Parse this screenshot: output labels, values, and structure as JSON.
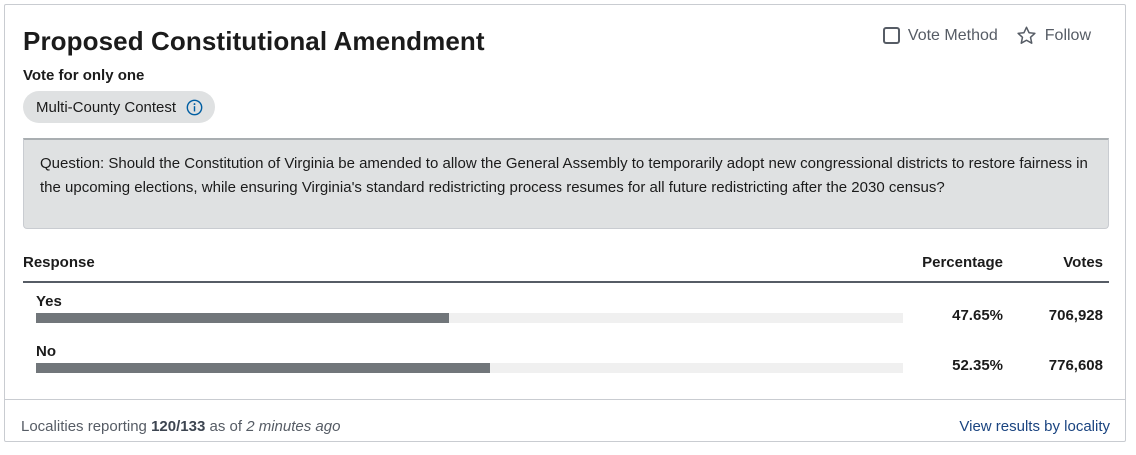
{
  "contest": {
    "title": "Proposed Constitutional Amendment",
    "subtitle": "Vote for only one",
    "scope_label": "Multi-County Contest",
    "info_icon": "info-icon"
  },
  "actions": {
    "vote_method_label": "Vote Method",
    "vote_method_checked": false,
    "follow_label": "Follow",
    "follow_icon": "star-outline-icon"
  },
  "question_text": "Question: Should the Constitution of Virginia be amended to allow the General Assembly to temporarily adopt new congressional districts to restore fairness in the upcoming elections, while ensuring Virginia's standard redistricting process resumes for all future redistricting after the 2030 census?",
  "table": {
    "headers": {
      "response": "Response",
      "percentage": "Percentage",
      "votes": "Votes"
    },
    "rows": [
      {
        "label": "Yes",
        "percentage": "47.65%",
        "votes": "706,928",
        "share": 0.4765
      },
      {
        "label": "No",
        "percentage": "52.35%",
        "votes": "776,608",
        "share": 0.5235
      }
    ]
  },
  "footer": {
    "prefix": "Localities reporting",
    "reporting": "120/133",
    "as_of": "as of",
    "time_ago": "2 minutes ago",
    "link_label": "View results by locality"
  },
  "colors": {
    "bar_fill": "#71767a",
    "bar_track": "#f0f0f0",
    "pill_bg": "#dfe1e2",
    "link": "#1a4480",
    "info_icon": "#005ea2"
  }
}
